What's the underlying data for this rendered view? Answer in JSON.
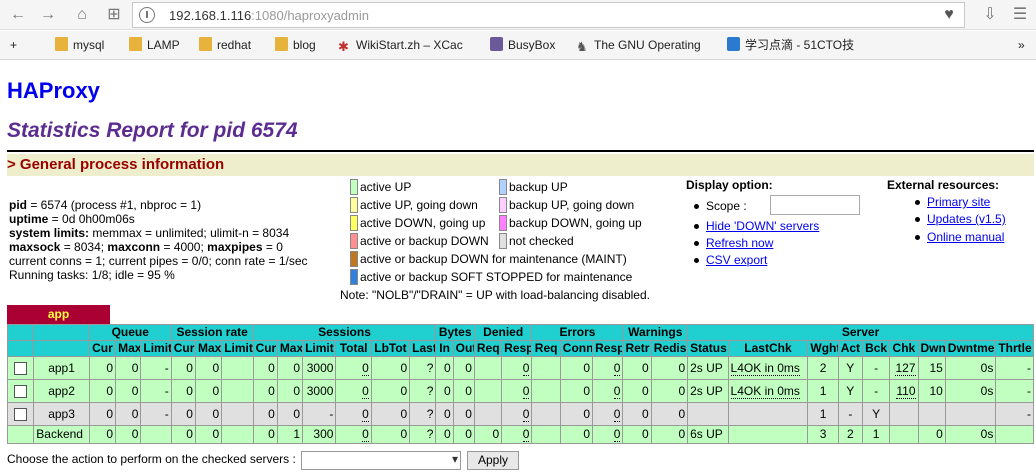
{
  "browser": {
    "url_host": "192.168.1.116",
    "url_rest": ":1080/haproxyadmin",
    "bookmarks": [
      "mysql",
      "LAMP",
      "redhat",
      "blog",
      "WikiStart.zh – XCac",
      "BusyBox",
      "The GNU Operating",
      "学习点滴 - 51CTO技"
    ]
  },
  "page": {
    "title": "HAProxy",
    "subtitle": "Statistics Report for pid 6574",
    "section": "> General process information"
  },
  "procinfo": {
    "pid_label": "pid",
    "pid_value": " = 6574 (process #1, nbproc = 1)",
    "uptime_label": "uptime",
    "uptime_value": " = 0d 0h00m06s",
    "limits_label": "system limits:",
    "limits_value": " memmax = unlimited; ulimit-n = 8034",
    "maxsock_label": "maxsock",
    "maxsock_value": " = 8034; ",
    "maxconn_label": "maxconn",
    "maxconn_value": " = 4000; ",
    "maxpipes_label": "maxpipes",
    "maxpipes_value": " = 0",
    "conns": "current conns = 1; current pipes = 0/0; conn rate = 1/sec",
    "tasks": "Running tasks: 1/8; idle = 95 %"
  },
  "legend": {
    "items": [
      {
        "label": "active UP",
        "color": "#c0ffc0"
      },
      {
        "label": "active UP, going down",
        "color": "#ffffa0"
      },
      {
        "label": "active DOWN, going up",
        "color": "#ffff60"
      },
      {
        "label": "active or backup DOWN",
        "color": "#ff9090"
      },
      {
        "label": "active or backup DOWN for maintenance (MAINT)",
        "color": "#c07820"
      },
      {
        "label": "active or backup SOFT STOPPED for maintenance",
        "color": "#3080e0"
      },
      {
        "label": "backup UP",
        "color": "#b0d0ff"
      },
      {
        "label": "backup UP, going down",
        "color": "#ffd0ff"
      },
      {
        "label": "backup DOWN, going up",
        "color": "#ff80ff"
      },
      {
        "label": "not checked",
        "color": "#e0e0e0"
      }
    ],
    "note": "Note: \"NOLB\"/\"DRAIN\" = UP with load-balancing disabled."
  },
  "display_option": {
    "heading": "Display option:",
    "scope": "Scope :",
    "hide_down": "Hide 'DOWN' servers",
    "refresh": "Refresh now",
    "csv": "CSV export"
  },
  "external": {
    "heading": "External resources:",
    "primary": "Primary site",
    "updates": "Updates (v1.5)",
    "manual": "Online manual"
  },
  "proxy": {
    "name": "app",
    "groups": [
      "Queue",
      "Session rate",
      "Sessions",
      "Bytes",
      "Denied",
      "Errors",
      "Warnings",
      "Server"
    ],
    "columns": [
      "Cur",
      "Max",
      "Limit",
      "Cur",
      "Max",
      "Limit",
      "Cur",
      "Max",
      "Limit",
      "Total",
      "LbTot",
      "Last",
      "In",
      "Out",
      "Req",
      "Resp",
      "Req",
      "Conn",
      "Resp",
      "Retr",
      "Redis",
      "Status",
      "LastChk",
      "Wght",
      "Act",
      "Bck",
      "Chk",
      "Dwn",
      "Dwntme",
      "Thrtle"
    ],
    "rows": [
      {
        "name": "app1",
        "cells": [
          "0",
          "0",
          "-",
          "0",
          "0",
          "",
          "0",
          "0",
          "3000",
          "0",
          "0",
          "?",
          "0",
          "0",
          "",
          "0",
          "",
          "0",
          "0",
          "0",
          "0",
          "2s UP",
          "L4OK in 0ms",
          "2",
          "Y",
          "-",
          "127",
          "15",
          "0s",
          "-"
        ]
      },
      {
        "name": "app2",
        "cells": [
          "0",
          "0",
          "-",
          "0",
          "0",
          "",
          "0",
          "0",
          "3000",
          "0",
          "0",
          "?",
          "0",
          "0",
          "",
          "0",
          "",
          "0",
          "0",
          "0",
          "0",
          "2s UP",
          "L4OK in 0ms",
          "1",
          "Y",
          "-",
          "110",
          "10",
          "0s",
          "-"
        ]
      },
      {
        "name": "app3",
        "cells": [
          "0",
          "0",
          "-",
          "0",
          "0",
          "",
          "0",
          "0",
          "-",
          "0",
          "0",
          "?",
          "0",
          "0",
          "",
          "0",
          "",
          "0",
          "0",
          "0",
          "0",
          "",
          "",
          "1",
          "-",
          "Y",
          "",
          "",
          "",
          "-"
        ]
      },
      {
        "name": "Backend",
        "cells": [
          "0",
          "0",
          "",
          "0",
          "0",
          "",
          "0",
          "1",
          "300",
          "0",
          "0",
          "?",
          "0",
          "0",
          "0",
          "0",
          "",
          "0",
          "0",
          "0",
          "0",
          "6s UP",
          "",
          "3",
          "2",
          "1",
          "",
          "0",
          "0s",
          ""
        ]
      }
    ]
  },
  "actions": {
    "label": "Choose the action to perform on the checked servers :",
    "apply": "Apply"
  },
  "colors": {
    "title": "#0000ee",
    "subtitle": "#5c2d91",
    "section_bg": "#eeeecc",
    "section_text": "#990000",
    "header_bg": "#20d0d0",
    "up_row": "#c0ffc0",
    "unchecked_row": "#e0e0e0",
    "proxy_title_bg": "#aa0033"
  }
}
